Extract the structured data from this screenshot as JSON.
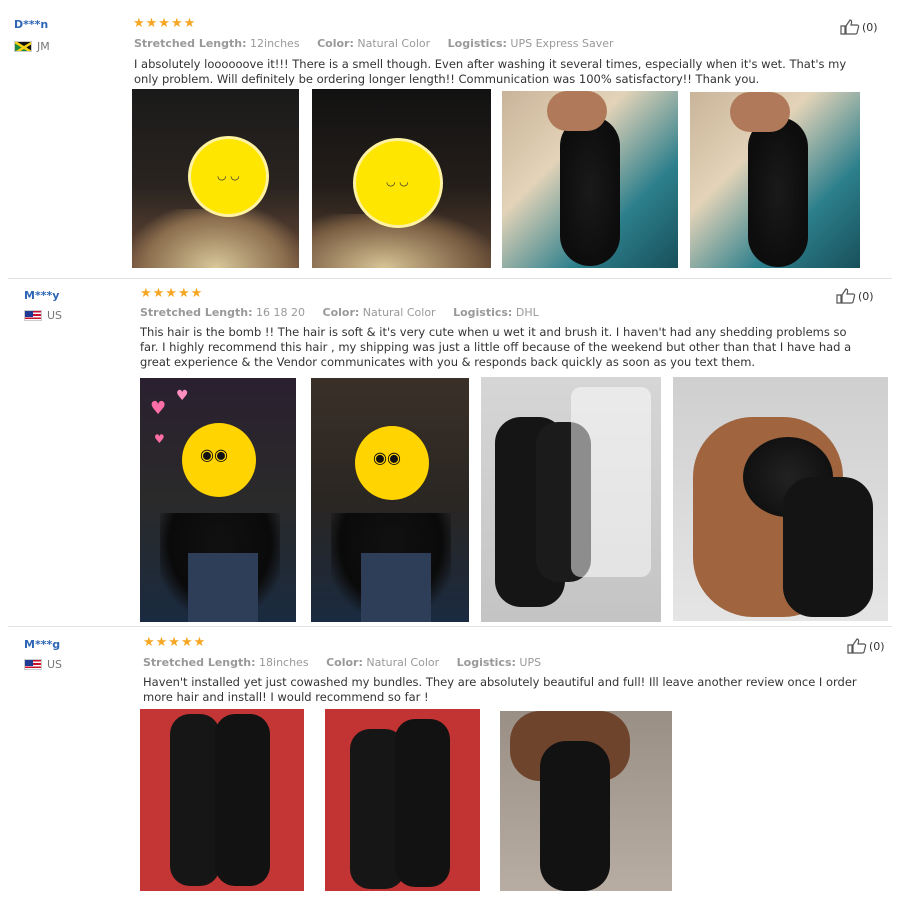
{
  "reviews": [
    {
      "user": "D***n",
      "country": "JM",
      "stars": "★★★★★",
      "length_label": "Stretched Length:",
      "length": "12inches",
      "color_label": "Color:",
      "color": "Natural Color",
      "logistics_label": "Logistics:",
      "logistics": "UPS Express Saver",
      "text": "I absolutely loooooove it!!! There is a smell though. Even after washing it several times, especially when it's wet. That's my only problem. Will definitely be ordering longer length!! Communication was 100% satisfactory!! Thank you.",
      "helpful": "(0)"
    },
    {
      "user": "M***y",
      "country": "US",
      "stars": "★★★★★",
      "length_label": "Stretched Length:",
      "length": "16 18 20",
      "color_label": "Color:",
      "color": "Natural Color",
      "logistics_label": "Logistics:",
      "logistics": "DHL",
      "text": "This hair is the bomb !! The hair is soft & it's very cute when u wet it and brush it. I haven't had any shedding problems so far. I highly recommend this hair , my shipping was just a little off because of the weekend but other than that I have had a great experience & the Vendor communicates with you & responds back quickly as soon as you text them.",
      "helpful": "(0)"
    },
    {
      "user": "M***g",
      "country": "US",
      "stars": "★★★★★",
      "length_label": "Stretched Length:",
      "length": "18inches",
      "color_label": "Color:",
      "color": "Natural Color",
      "logistics_label": "Logistics:",
      "logistics": "UPS",
      "text": "Haven't installed yet just cowashed my bundles. They are absolutely beautiful and full! Ill leave another review once I order more hair and install! I would recommend so far !",
      "helpful": "(0)"
    }
  ]
}
